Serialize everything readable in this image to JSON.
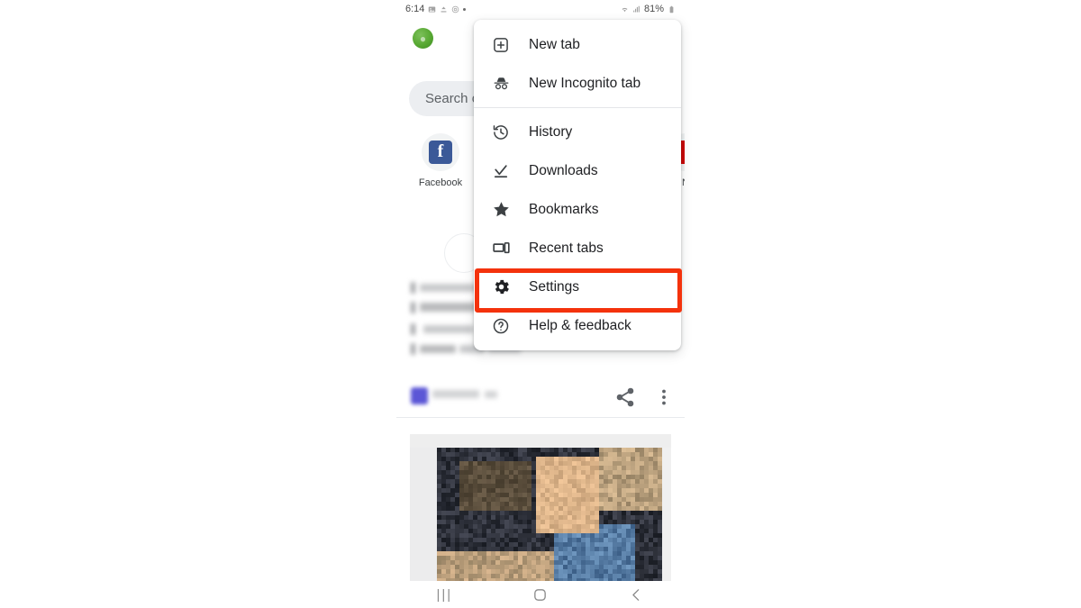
{
  "status_bar": {
    "time": "6:14",
    "battery_percent": "81%",
    "left_icons": [
      "image-icon",
      "upload-icon",
      "target-icon",
      "dot-icon"
    ],
    "right_icons": [
      "wifi-icon",
      "signal-icon",
      "battery-icon"
    ]
  },
  "ntp": {
    "avatar_label": "account-avatar",
    "search": {
      "text": "Search o",
      "placeholder": "Search or type web address"
    },
    "tiles": [
      {
        "label": "Facebook",
        "icon": "facebook-icon",
        "letter": "f"
      },
      {
        "label": "N",
        "icon": "cnn-icon",
        "letter": ""
      }
    ]
  },
  "menu": {
    "items": [
      {
        "label": "New tab",
        "icon": "new-tab-icon",
        "name": "menu-item-new-tab"
      },
      {
        "label": "New Incognito tab",
        "icon": "incognito-icon",
        "name": "menu-item-new-incognito-tab"
      },
      {
        "label": "History",
        "icon": "history-icon",
        "name": "menu-item-history"
      },
      {
        "label": "Downloads",
        "icon": "download-icon",
        "name": "menu-item-downloads"
      },
      {
        "label": "Bookmarks",
        "icon": "star-icon",
        "name": "menu-item-bookmarks"
      },
      {
        "label": "Recent tabs",
        "icon": "recent-tabs-icon",
        "name": "menu-item-recent-tabs"
      },
      {
        "label": "Settings",
        "icon": "gear-icon",
        "name": "menu-item-settings"
      },
      {
        "label": "Help & feedback",
        "icon": "help-icon",
        "name": "menu-item-help-and-feedback"
      }
    ],
    "highlighted_item": "Settings",
    "highlight_color": "#f4320c"
  },
  "feed": {
    "actions": {
      "share": "share-icon",
      "more": "more-vertical-icon"
    },
    "photo_alt": "blurred-article-thumbnail"
  },
  "nav_bar": {
    "recents": "|||",
    "home": "home-icon",
    "back": "back-icon"
  }
}
